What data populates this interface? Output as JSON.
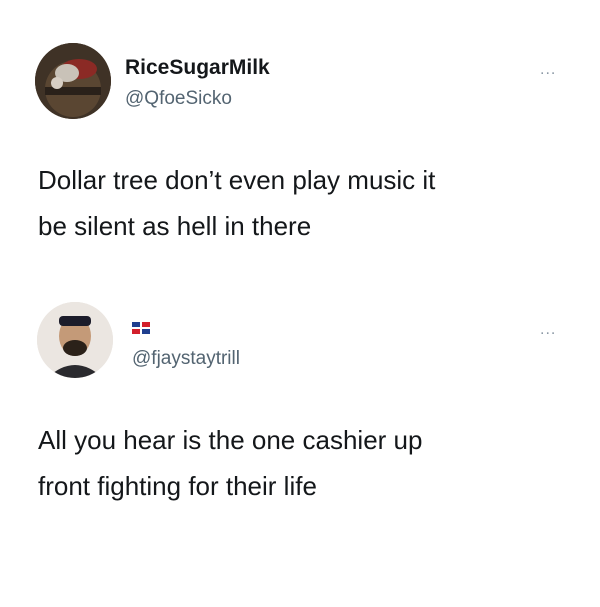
{
  "tweets": [
    {
      "display_name": "RiceSugarMilk",
      "handle": "@QfoeSicko",
      "more_label": "...",
      "avatar_icon": "profile-photo",
      "text_lines": [
        "Dollar tree don’t even play music it",
        "be silent as hell in there"
      ]
    },
    {
      "display_name": "",
      "handle": "@fjaystaytrill",
      "more_label": "...",
      "avatar_icon": "profile-photo",
      "name_icon": "dominican-republic-flag-icon",
      "text_lines": [
        "All you hear is the one cashier up",
        "front fighting for their life"
      ]
    }
  ],
  "colors": {
    "background": "#ffffff",
    "text": "#14171a",
    "handle": "#536471",
    "more": "#8b98a5",
    "flag_blue": "#1f3f8f",
    "flag_red": "#d21f2b"
  }
}
